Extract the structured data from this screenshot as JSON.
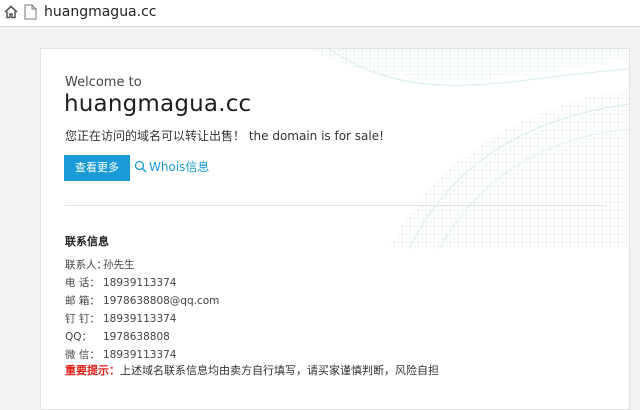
{
  "browser": {
    "url": "huangmagua.cc"
  },
  "hero": {
    "welcome": "Welcome to",
    "domain": "huangmagua.cc",
    "sale_text": "您正在访问的域名可以转让出售！ the domain is for sale!",
    "more_button": "查看更多",
    "whois_link": "Whois信息"
  },
  "contact": {
    "heading": "联系信息",
    "rows": [
      {
        "label": "联系人：",
        "value": "孙先生"
      },
      {
        "label": "电  话：",
        "value": "18939113374"
      },
      {
        "label": "邮  箱：",
        "value": "1978638808@qq.com"
      },
      {
        "label": "钉  钉：",
        "value": "18939113374"
      },
      {
        "label": "QQ：",
        "value": "1978638808"
      },
      {
        "label": "微  信：",
        "value": "18939113374"
      }
    ],
    "notice_label": "重要提示：",
    "notice_text": "上述域名联系信息均由卖方自行填写，请买家谨慎判断，风险自担"
  },
  "colors": {
    "accent": "#1a9ad6",
    "warning": "#e0231c"
  },
  "icons": [
    "home-icon",
    "page-icon",
    "search-icon"
  ]
}
